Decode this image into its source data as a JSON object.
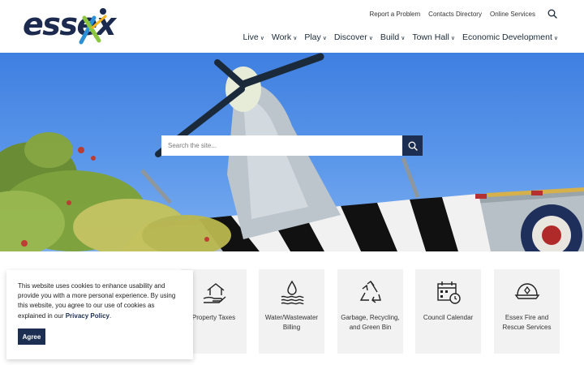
{
  "logo": {
    "text": "essex"
  },
  "utility_nav": [
    {
      "label": "Report a Problem"
    },
    {
      "label": "Contacts Directory"
    },
    {
      "label": "Online Services"
    }
  ],
  "main_nav": [
    {
      "label": "Live"
    },
    {
      "label": "Work"
    },
    {
      "label": "Play"
    },
    {
      "label": "Discover"
    },
    {
      "label": "Build"
    },
    {
      "label": "Town Hall"
    },
    {
      "label": "Economic Development"
    }
  ],
  "search": {
    "placeholder": "Search the site..."
  },
  "tiles": [
    {
      "label": "Property Taxes",
      "icon": "house-hand-icon"
    },
    {
      "label": "Water/Wastewater Billing",
      "icon": "water-drop-icon"
    },
    {
      "label": "Garbage, Recycling, and Green Bin",
      "icon": "recycle-icon"
    },
    {
      "label": "Council Calendar",
      "icon": "calendar-clock-icon"
    },
    {
      "label": "Essex Fire and Rescue Services",
      "icon": "fire-helmet-icon"
    }
  ],
  "cookie": {
    "text": "This website uses cookies to enhance usability and provide you with a more personal experience. By using this website, you agree to our use of cookies as explained in our ",
    "link": "Privacy Policy",
    "end": ".",
    "agree": "Agree"
  },
  "colors": {
    "navy": "#1c2f52",
    "sky": "#4a88e6",
    "tile_bg": "#f2f2f2",
    "logo_green": "#8cc63f",
    "logo_blue": "#2a8fd6"
  }
}
